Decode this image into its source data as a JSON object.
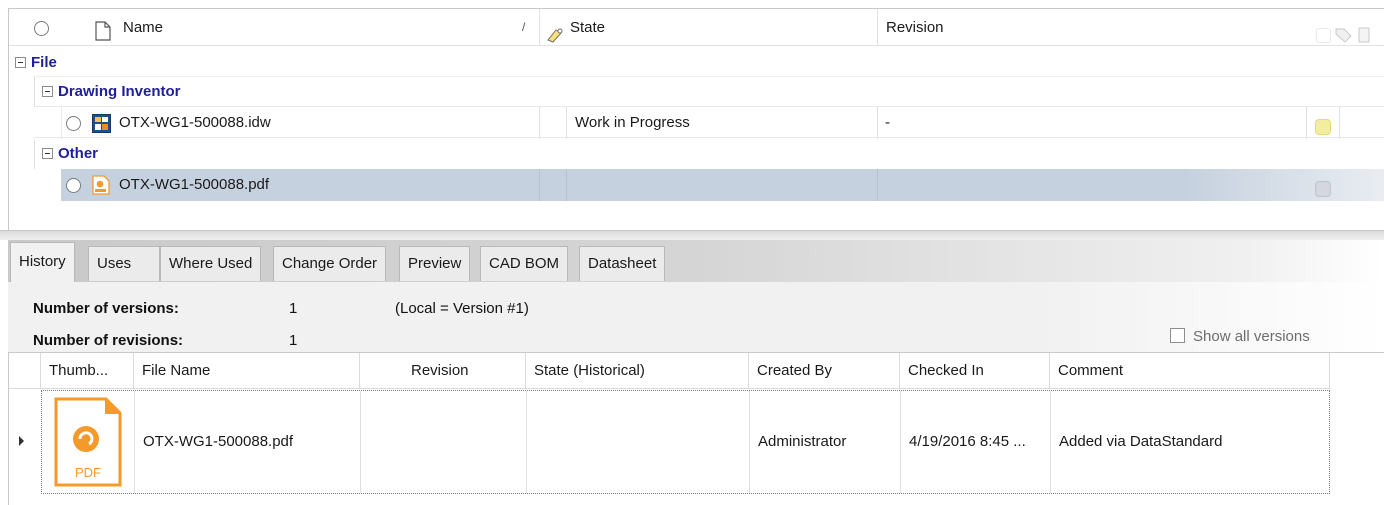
{
  "top_grid": {
    "columns": {
      "name": "Name",
      "sort_indicator": "/",
      "state": "State",
      "revision": "Revision"
    },
    "groups": [
      {
        "label": "File"
      },
      {
        "label": "Drawing Inventor"
      },
      {
        "label": "Other"
      }
    ],
    "rows": [
      {
        "name": "OTX-WG1-500088.idw",
        "state": "Work in Progress",
        "revision": "-",
        "icon": "inventor-drawing-icon",
        "swatch_color": "#f2ee9c",
        "selected": false
      },
      {
        "name": "OTX-WG1-500088.pdf",
        "state": "",
        "revision": "",
        "icon": "pdf-file-icon",
        "swatch_color": "#d4d7dd",
        "selected": true
      }
    ]
  },
  "tabs": [
    "History",
    "Uses",
    "Where Used",
    "Change Order",
    "Preview",
    "CAD BOM",
    "Datasheet"
  ],
  "active_tab": "History",
  "summary": {
    "versions_label": "Number of versions:",
    "versions_value": "1",
    "local_note": "(Local = Version #1)",
    "revisions_label": "Number of revisions:",
    "revisions_value": "1",
    "show_all_versions": "Show all versions"
  },
  "history_table": {
    "columns": [
      "Thumb...",
      "File Name",
      "Revision",
      "State (Historical)",
      "Created By",
      "Checked In",
      "Comment"
    ],
    "rows": [
      {
        "thumbnail_text": "PDF",
        "file_name": "OTX-WG1-500088.pdf",
        "revision": "",
        "state": "",
        "created_by": "Administrator",
        "checked_in": "4/19/2016 8:45 ...",
        "comment": "Added via DataStandard"
      }
    ]
  },
  "colors": {
    "group_text": "#1f1f9a",
    "selected_row": "#c6d1df",
    "pdf_orange": "#f39a2b",
    "wip_swatch": "#f2ee9c"
  }
}
